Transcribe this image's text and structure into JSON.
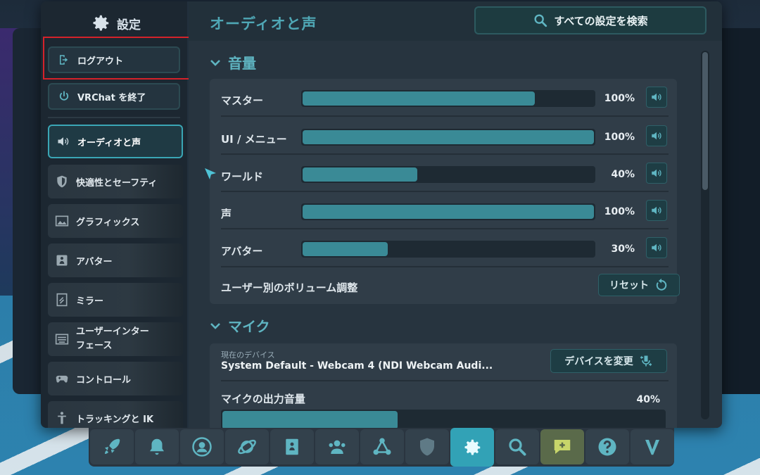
{
  "nav": {
    "title": "設定",
    "logout": "ログアウト",
    "quit": "VRChat を終了",
    "items": [
      {
        "label": "オーディオと声",
        "icon": "speaker-icon",
        "active": true
      },
      {
        "label": "快適性とセーフティ",
        "icon": "shield-icon"
      },
      {
        "label": "グラフィックス",
        "icon": "image-icon"
      },
      {
        "label": "アバター",
        "icon": "avatar-icon"
      },
      {
        "label": "ミラー",
        "icon": "mirror-icon"
      },
      {
        "label": "ユーザーインター",
        "label2": "フェース",
        "icon": "keyboard-icon"
      },
      {
        "label": "コントロール",
        "icon": "gamepad-icon"
      },
      {
        "label": "トラッキングと IK",
        "icon": "tracking-icon"
      }
    ]
  },
  "content": {
    "title": "オーディオと声",
    "search_label": "すべての設定を検索",
    "volume": {
      "heading": "音量",
      "rows": [
        {
          "label": "マスター",
          "value": "100%",
          "fill": 0.8
        },
        {
          "label": "UI / メニュー",
          "value": "100%",
          "fill": 1.0
        },
        {
          "label": "ワールド",
          "value": "40%",
          "fill": 0.4
        },
        {
          "label": "声",
          "value": "100%",
          "fill": 1.0
        },
        {
          "label": "アバター",
          "value": "30%",
          "fill": 0.3
        }
      ],
      "per_user_label": "ユーザー別のボリューム調整",
      "reset_label": "リセット"
    },
    "mic": {
      "heading": "マイク",
      "device_caption": "現在のデバイス",
      "device_name": "System Default - Webcam 4 (NDI Webcam Audi...",
      "change_device_label": "デバイスを変更",
      "output_label": "マイクの出力音量",
      "output_value": "40%",
      "output_fill": 0.4
    }
  },
  "dock": [
    "launch-icon",
    "bell-icon",
    "profile-icon",
    "planet-icon",
    "book-icon",
    "people-icon",
    "network-icon",
    "safety-icon",
    "settings-icon",
    "search-icon",
    "chat-icon",
    "help-icon",
    "vrchat-logo-icon"
  ],
  "colors": {
    "accent": "#3a8a96",
    "title": "#4fa7b5",
    "active_tab": "#32a2b6",
    "highlight": "#d4222a"
  }
}
